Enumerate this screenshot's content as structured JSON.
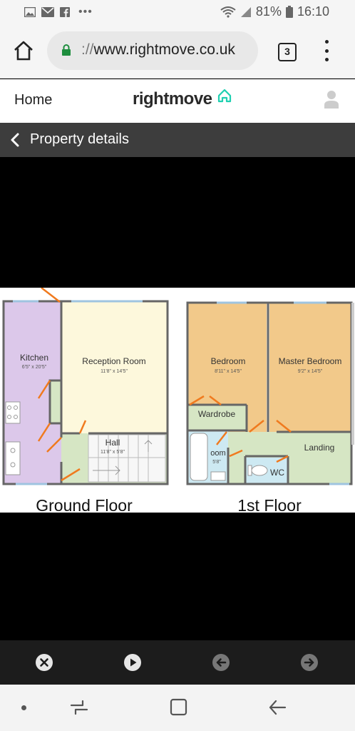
{
  "status_bar": {
    "battery": "81%",
    "time": "16:10",
    "icons": [
      "gallery-icon",
      "mail-icon",
      "facebook-icon",
      "more-dots-icon",
      "wifi-icon",
      "signal-icon",
      "battery-icon"
    ]
  },
  "browser": {
    "url_scheme": "://",
    "url_host": "www.rightmove.co.uk",
    "tab_count": "3"
  },
  "site_header": {
    "home_label": "Home",
    "logo_text": "rightmove"
  },
  "detail_bar": {
    "title": "Property details"
  },
  "floorplan": {
    "ground_floor": {
      "label": "Ground Floor",
      "rooms": [
        {
          "name": "Kitchen",
          "size": "6'5\" x 20'5\""
        },
        {
          "name": "Reception Room",
          "size": "11'8\" x 14'5\""
        },
        {
          "name": "Hall",
          "size": "11'8\" x 5'8\""
        }
      ]
    },
    "first_floor": {
      "label": "1st Floor",
      "rooms": [
        {
          "name": "Bedroom",
          "size": "8'11\" x 14'5\""
        },
        {
          "name": "Master Bedroom",
          "size": "9'2\" x 14'5\""
        },
        {
          "name": "Wardrobe",
          "size": ""
        },
        {
          "name": "oom",
          "size": "5'8\""
        },
        {
          "name": "WC",
          "size": ""
        },
        {
          "name": "Landing",
          "size": ""
        }
      ]
    },
    "colors": {
      "kitchen": "#dcc8ea",
      "reception": "#fdf8dc",
      "hall": "#d6e6c4",
      "bedroom": "#f2c98a",
      "wardrobe": "#d6e6c4",
      "bathroom": "#cde9f2",
      "landing": "#d6e6c4",
      "wall": "#666666",
      "door": "#f07a1e"
    }
  },
  "gallery_controls": [
    "close-icon",
    "play-icon",
    "previous-icon",
    "next-icon"
  ],
  "nav_bar": [
    "nav-dot-icon",
    "recent-apps-icon",
    "home-square-icon",
    "back-arrow-icon"
  ]
}
